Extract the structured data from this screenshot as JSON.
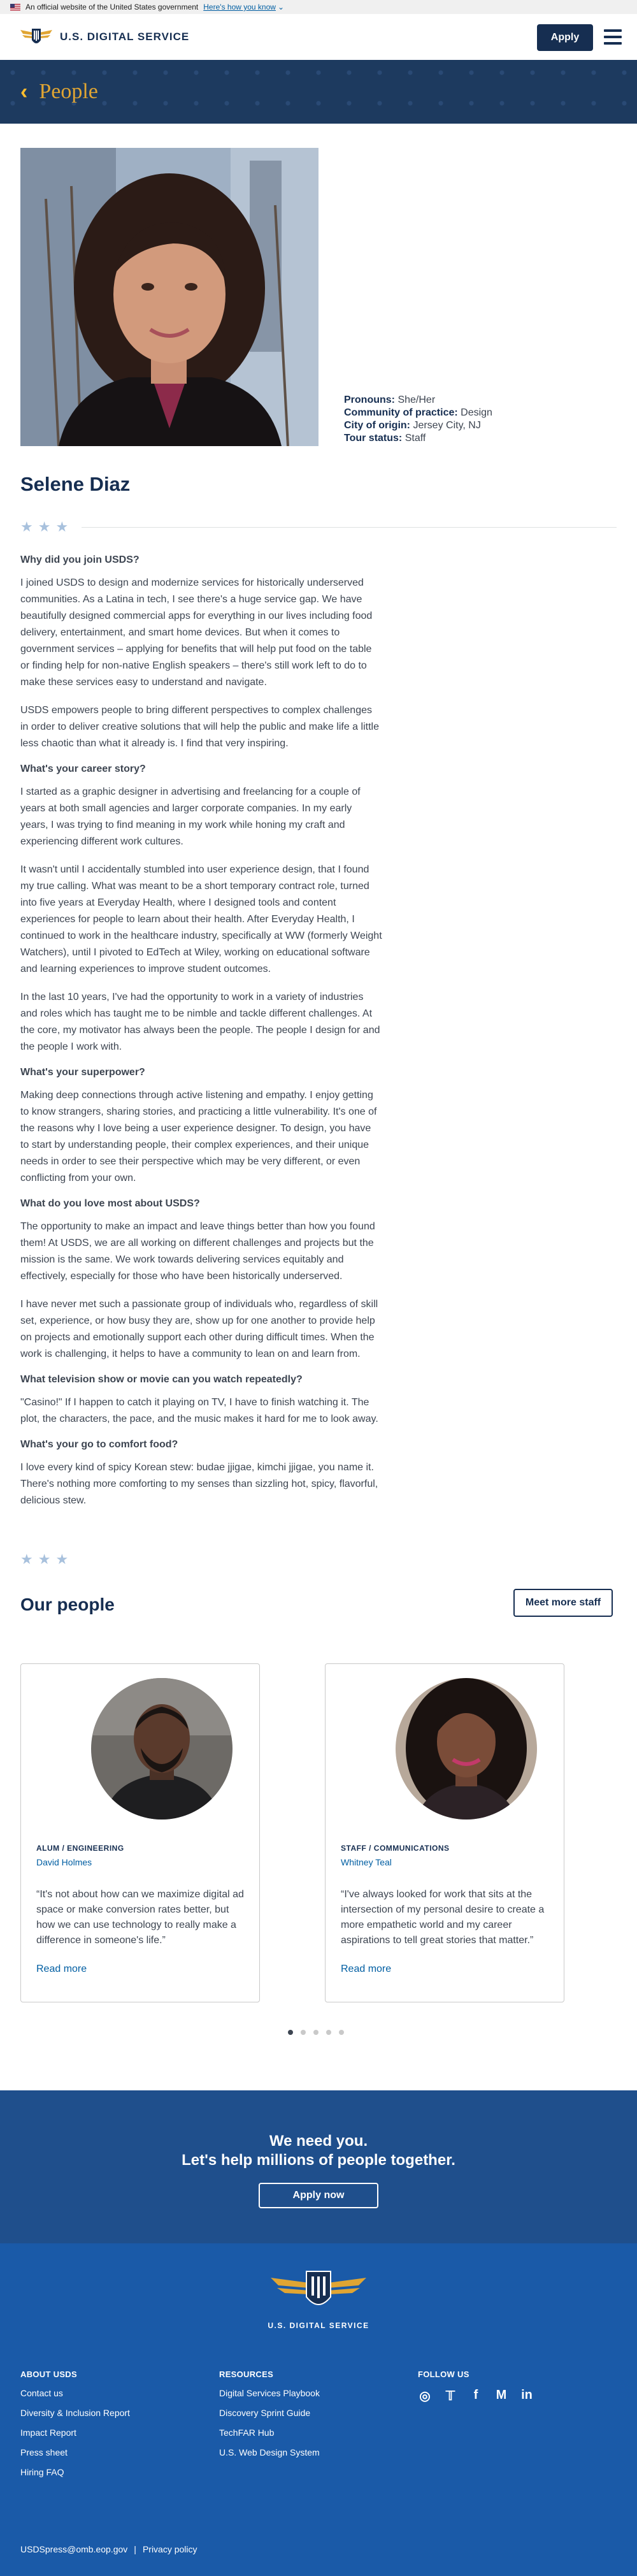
{
  "gov_banner": {
    "text": "An official website of the United States government",
    "link": "Here's how you know",
    "chevron": "⌄"
  },
  "header": {
    "logo_text": "U.S. DIGITAL SERVICE",
    "apply_label": "Apply",
    "menu_icon": "hamburger-icon"
  },
  "hero": {
    "back_glyph": "‹",
    "title": "People"
  },
  "profile": {
    "name": "Selene Diaz",
    "facts": [
      {
        "label": "Pronouns:",
        "value": "She/Her"
      },
      {
        "label": "Community of practice:",
        "value": "Design"
      },
      {
        "label": "City of origin:",
        "value": "Jersey City, NJ"
      },
      {
        "label": "Tour status:",
        "value": "Staff"
      }
    ],
    "star_glyph": "★"
  },
  "article": {
    "q1": "Why did you join USDS?",
    "p1": "I joined USDS to design and modernize services for historically underserved communities. As a Latina in tech, I see there's a huge service gap. We have beautifully designed commercial apps for everything in our lives including food delivery, entertainment, and smart home devices. But when it comes to government services – applying for benefits that will help put food on the table or finding help for non-native English speakers – there's still work left to do to make these services easy to understand and navigate.",
    "p2": "USDS empowers people to bring different perspectives to complex challenges in order to deliver creative solutions that will help the public and make life a little less chaotic than what it already is. I find that very inspiring.",
    "q2": "What's your career story?",
    "p3": "I started as a graphic designer in advertising and freelancing for a couple of years at both small agencies and larger corporate companies. In my early years, I was trying to find meaning in my work while honing my craft and experiencing different work cultures.",
    "p4": "It wasn't until I accidentally stumbled into user experience design, that I found my true calling. What was meant to be a short temporary contract role, turned into five years at Everyday Health, where I designed tools and content experiences for people to learn about their health. After Everyday Health, I continued to work in the healthcare industry, specifically at WW (formerly Weight Watchers), until I pivoted to EdTech at Wiley, working on educational software and learning experiences to improve student outcomes.",
    "p5": "In the last 10 years, I've had the opportunity to work in a variety of industries and roles which has taught me to be nimble and tackle different challenges. At the core, my motivator has always been the people. The people I design for and the people I work with.",
    "q3": "What's your superpower?",
    "p6": "Making deep connections through active listening and empathy. I enjoy getting to know strangers, sharing stories, and practicing a little vulnerability. It's one of the reasons why I love being a user experience designer. To design, you have to start by understanding people, their complex experiences, and their unique needs in order to see their perspective which may be very different, or even conflicting from your own.",
    "q4": "What do you love most about USDS?",
    "p7": "The opportunity to make an impact and leave things better than how you found them! At USDS, we are all working on different challenges and projects but the mission is the same. We work towards delivering services equitably and effectively, especially for those who have been historically underserved.",
    "p8": "I have never met such a passionate group of individuals who, regardless of skill set, experience, or how busy they are, show up for one another to provide help on projects and emotionally support each other during difficult times. When the work is challenging, it helps to have a community to lean on and learn from.",
    "q5": "What television show or movie can you watch repeatedly?",
    "p9": "\"Casino!\" If I happen to catch it playing on TV, I have to finish watching it. The plot, the characters, the pace, and the music makes it hard for me to look away.",
    "q6": "What's your go to comfort food?",
    "p10": "I love every kind of spicy Korean stew: budae jjigae, kimchi jjigae, you name it. There's nothing more comforting to my senses than sizzling hot, spicy, flavorful, delicious stew."
  },
  "our_people": {
    "title": "Our people",
    "meet_label": "Meet more staff",
    "cards": [
      {
        "role": "ALUM / ENGINEERING",
        "name": "David Holmes",
        "quote": "“It's not about how can we maximize digital ad space or make conversion rates better, but how we can use technology to really make a difference in someone's life.”",
        "link": "Read more"
      },
      {
        "role": "STAFF / COMMUNICATIONS",
        "name": "Whitney Teal",
        "quote": "“I've always looked for work that sits at the intersection of my personal desire to create a more empathetic world and my career aspirations to tell great stories that matter.”",
        "link": "Read more"
      }
    ],
    "carousel": {
      "active_index": 0,
      "total": 5
    }
  },
  "cta": {
    "line1": "We need you.",
    "line2": "Let's help millions of people together.",
    "button": "Apply now"
  },
  "footer": {
    "logo_text": "U.S. DIGITAL SERVICE",
    "about": {
      "heading": "ABOUT USDS",
      "links": [
        "Contact us",
        "Diversity & Inclusion Report",
        "Impact Report",
        "Press sheet",
        "Hiring FAQ"
      ]
    },
    "resources": {
      "heading": "RESOURCES",
      "links": [
        "Digital Services Playbook",
        "Discovery Sprint Guide",
        "TechFAR Hub",
        "U.S. Web Design System"
      ]
    },
    "follow": {
      "heading": "FOLLOW US",
      "icons": [
        {
          "name": "instagram-icon",
          "glyph": "◎"
        },
        {
          "name": "twitter-icon",
          "glyph": "𝕋"
        },
        {
          "name": "facebook-icon",
          "glyph": "f"
        },
        {
          "name": "medium-icon",
          "glyph": "M"
        },
        {
          "name": "linkedin-icon",
          "glyph": "in"
        }
      ]
    },
    "email": "USDSpress@omb.eop.gov",
    "separator": "|",
    "privacy": "Privacy policy"
  },
  "colors": {
    "navy": "#162e51",
    "gold": "#e0a533",
    "cta_blue": "#1f4f8c",
    "footer_blue": "#1a5aa8",
    "link_blue": "#005ea2"
  }
}
